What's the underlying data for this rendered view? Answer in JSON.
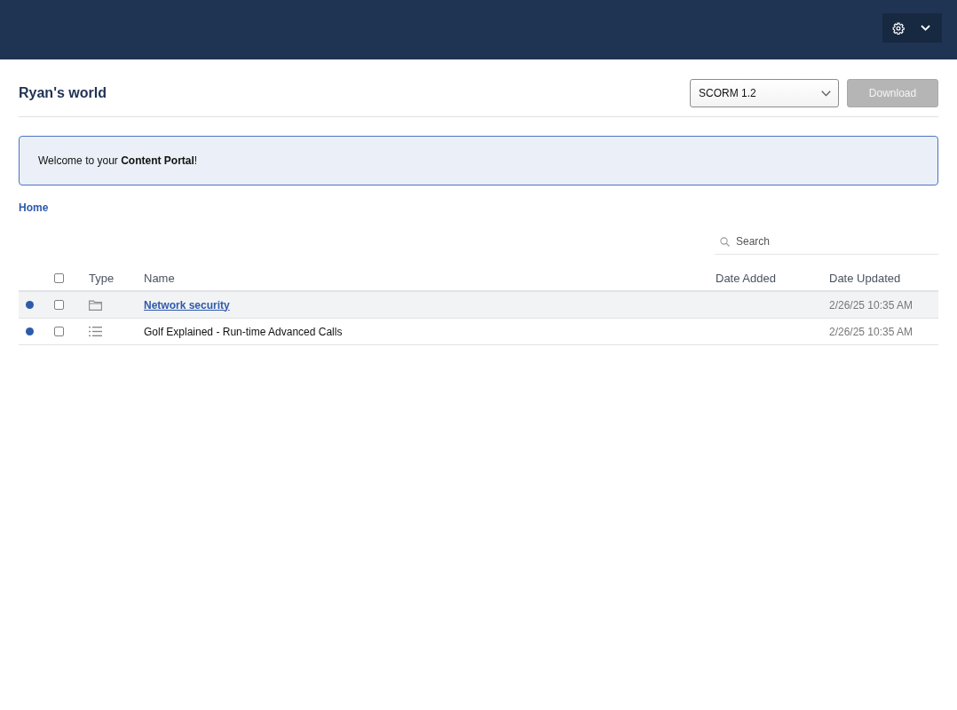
{
  "page_title": "Ryan's world",
  "format_select": {
    "value": "SCORM 1.2"
  },
  "download_button": {
    "label": "Download",
    "disabled": true
  },
  "banner": {
    "text": "Welcome to your **Content Portal**!"
  },
  "breadcrumb": [
    {
      "label": "Home"
    }
  ],
  "search": {
    "placeholder": "Search"
  },
  "table": {
    "select_all": {
      "checked": false
    },
    "columns": [
      "Type",
      "Name",
      "Date Added",
      "Date Updated"
    ],
    "rows": [
      {
        "new": true,
        "checked": false,
        "hovered": true,
        "kind": "folder",
        "name": "Network security",
        "date_updated": "2/26/25 10:35 AM"
      },
      {
        "new": true,
        "checked": false,
        "hovered": false,
        "kind": "course",
        "name": "Golf Explained - Run-time Advanced Calls",
        "date_updated": "2/26/25 10:35 AM"
      }
    ]
  }
}
